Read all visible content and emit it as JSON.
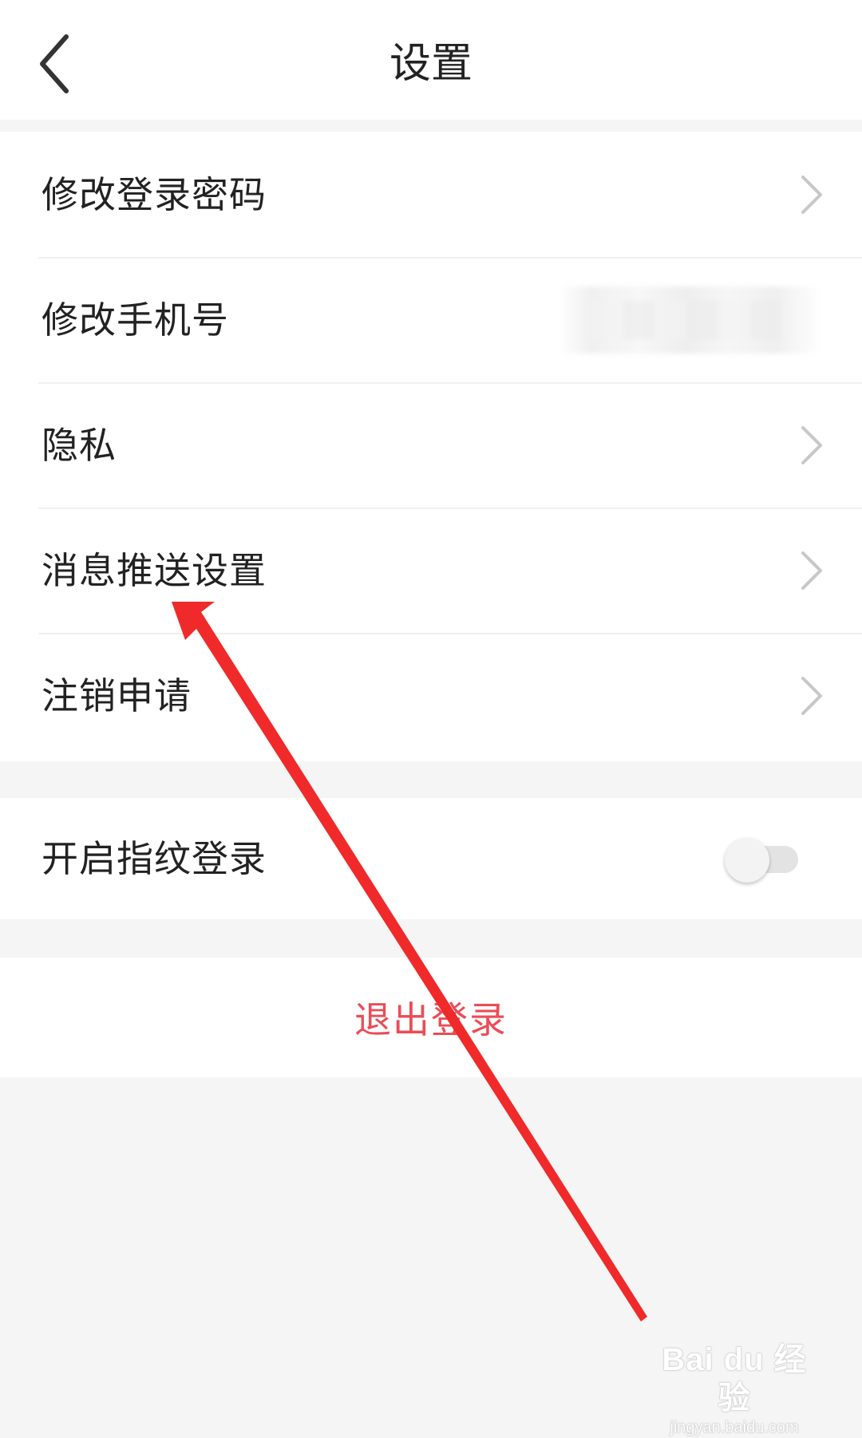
{
  "header": {
    "title": "设置",
    "back_icon": "chevron-left-icon"
  },
  "settings_list": {
    "items": [
      {
        "label": "修改登录密码",
        "has_chevron": true
      },
      {
        "label": "修改手机号",
        "value_masked": true
      },
      {
        "label": "隐私",
        "has_chevron": true
      },
      {
        "label": "消息推送设置",
        "has_chevron": true
      },
      {
        "label": "注销申请",
        "has_chevron": true
      }
    ]
  },
  "fingerprint": {
    "label": "开启指纹登录",
    "enabled": false
  },
  "logout": {
    "label": "退出登录"
  },
  "colors": {
    "logout_text": "#ea4d57",
    "annotation_arrow": "#f02a2a",
    "background": "#f5f5f5"
  },
  "watermark": {
    "logo": "Bai du 经验",
    "url": "jingyan.baidu.com"
  }
}
